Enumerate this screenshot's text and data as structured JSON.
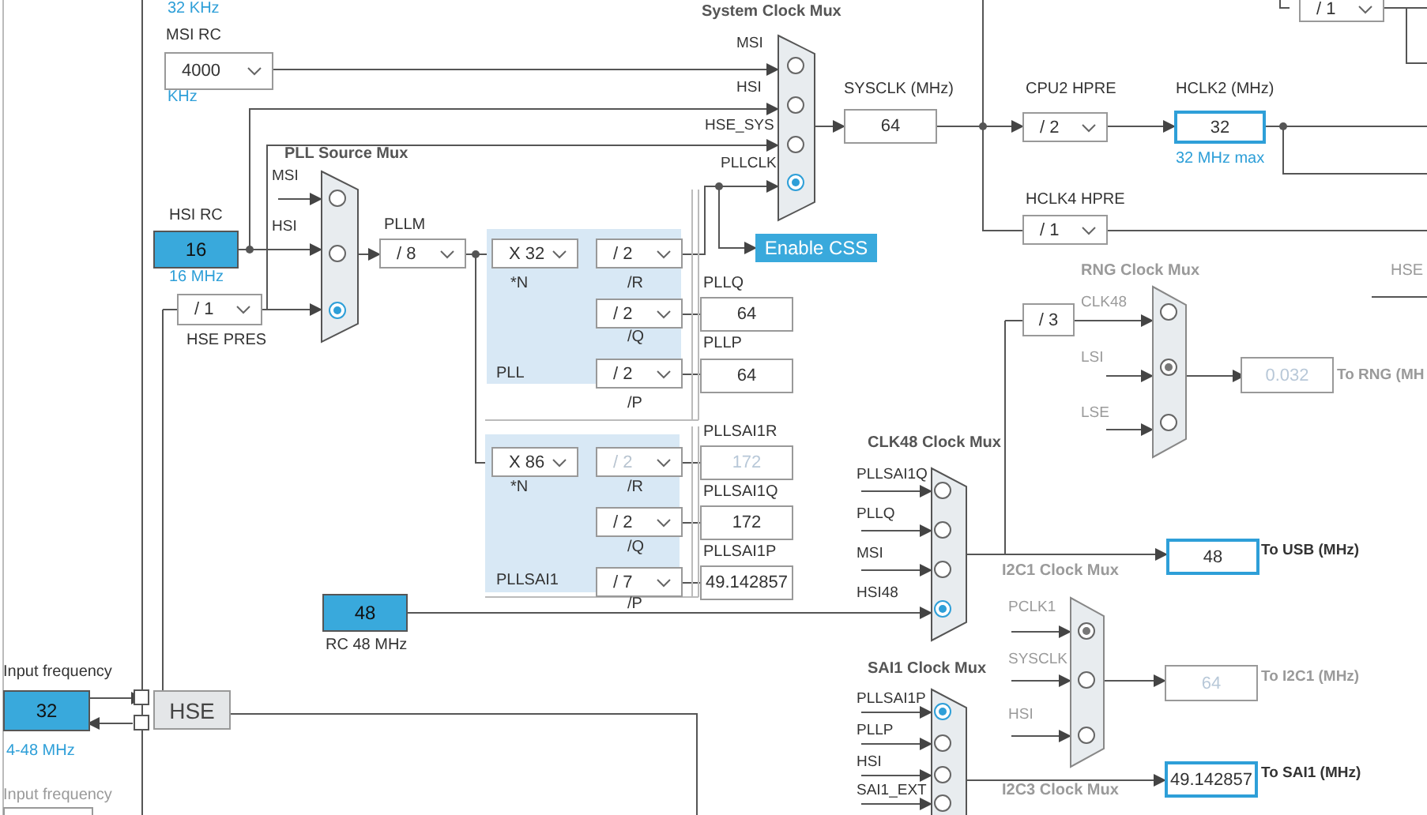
{
  "lse_unit": "32 KHz",
  "msi_rc": {
    "label": "MSI RC",
    "value": "4000",
    "unit": "KHz"
  },
  "hsi_rc": {
    "label": "HSI RC",
    "value": "16",
    "unit": "16 MHz"
  },
  "hse_pres": {
    "label": "HSE PRES",
    "value": "/ 1"
  },
  "pll_source_mux": {
    "title": "PLL Source Mux",
    "disabled": false,
    "inputs": [
      {
        "label": "MSI",
        "selected": false
      },
      {
        "label": "HSI",
        "selected": false
      },
      {
        "selected": true
      }
    ]
  },
  "pllm": {
    "label": "PLLM",
    "value": "/ 8"
  },
  "pll": {
    "label": "PLL",
    "multiplier": {
      "value": "X 32",
      "label": "*N"
    },
    "dividers": [
      {
        "value": "/ 2",
        "label": "/R",
        "disabled": false
      },
      {
        "value": "/ 2",
        "label": "/Q",
        "disabled": false
      },
      {
        "value": "/ 2",
        "label": "/P",
        "disabled": false
      }
    ],
    "outputs": [
      {
        "label": "PLLQ",
        "value": "64",
        "disabled": false
      },
      {
        "label": "PLLP",
        "value": "64",
        "disabled": false
      }
    ]
  },
  "pllsai1": {
    "label": "PLLSAI1",
    "multiplier": {
      "value": "X 86",
      "label": "*N"
    },
    "dividers": [
      {
        "value": "/ 2",
        "label": "/R",
        "disabled": true
      },
      {
        "value": "/ 2",
        "label": "/Q",
        "disabled": false
      },
      {
        "value": "/ 7",
        "label": "/P",
        "disabled": false
      }
    ],
    "outputs": [
      {
        "label": "PLLSAI1R",
        "value": "172",
        "disabled": true
      },
      {
        "label": "PLLSAI1Q",
        "value": "172",
        "disabled": false
      },
      {
        "label": "PLLSAI1P",
        "value": "49.142857",
        "disabled": false
      }
    ]
  },
  "system_clock_mux": {
    "title": "System Clock Mux",
    "disabled": false,
    "inputs": [
      {
        "label": "MSI",
        "selected": false
      },
      {
        "label": "HSI",
        "selected": false
      },
      {
        "label": "HSE_SYS",
        "selected": false
      },
      {
        "label": "PLLCLK",
        "selected": true
      }
    ]
  },
  "enable_css": "Enable CSS",
  "sysclk": {
    "label": "SYSCLK (MHz)",
    "value": "64"
  },
  "cpu2_hpre": {
    "label": "CPU2 HPRE",
    "value": "/ 2"
  },
  "hclk2": {
    "label": "HCLK2 (MHz)",
    "value": "32",
    "note": "32 MHz max",
    "highlighted": true
  },
  "hclk4_hpre": {
    "label": "HCLK4 HPRE",
    "value": "/ 1"
  },
  "top_divider": {
    "value": "/ 1"
  },
  "rng_divider": "/ 3",
  "rng_clock_mux": {
    "title": "RNG Clock Mux",
    "disabled": true,
    "inputs": [
      {
        "label": "CLK48",
        "selected": false
      },
      {
        "label": "LSI",
        "selected": true
      },
      {
        "label": "LSE",
        "selected": false
      }
    ],
    "output": {
      "value": "0.032",
      "label": "To RNG (MH",
      "highlighted": false,
      "disabled": true
    }
  },
  "hse_edge_label": "HSE",
  "clk48_clock_mux": {
    "title": "CLK48 Clock Mux",
    "disabled": false,
    "inputs": [
      {
        "label": "PLLSAI1Q",
        "selected": false
      },
      {
        "label": "PLLQ",
        "selected": false
      },
      {
        "label": "MSI",
        "selected": false
      },
      {
        "label": "HSI48",
        "selected": true
      }
    ],
    "output": {
      "value": "48",
      "label": "To USB (MHz)",
      "highlighted": true,
      "disabled": false
    }
  },
  "i2c1_clock_mux": {
    "title": "I2C1 Clock Mux",
    "disabled": true,
    "inputs": [
      {
        "label": "PCLK1",
        "selected": true
      },
      {
        "label": "SYSCLK",
        "selected": false
      },
      {
        "label": "HSI",
        "selected": false
      }
    ],
    "output": {
      "value": "64",
      "label": "To I2C1 (MHz)",
      "highlighted": false,
      "disabled": true
    }
  },
  "rc48": {
    "value": "48",
    "label": "RC 48 MHz"
  },
  "hse": {
    "input_label": "Input frequency",
    "value": "32",
    "range": "4-48 MHz",
    "label": "HSE"
  },
  "lse_input": {
    "input_label": "Input frequency"
  },
  "sai1_clock_mux": {
    "title": "SAI1 Clock Mux",
    "disabled": false,
    "inputs": [
      {
        "label": "PLLSAI1P",
        "selected": true
      },
      {
        "label": "PLLP",
        "selected": false
      },
      {
        "label": "HSI",
        "selected": false
      },
      {
        "label": "SAI1_EXT",
        "selected": false
      }
    ],
    "output": {
      "value": "49.142857",
      "label": "To SAI1 (MHz)",
      "highlighted": true,
      "disabled": false
    }
  },
  "i2c3_clock_mux": {
    "title": "I2C3 Clock Mux"
  }
}
